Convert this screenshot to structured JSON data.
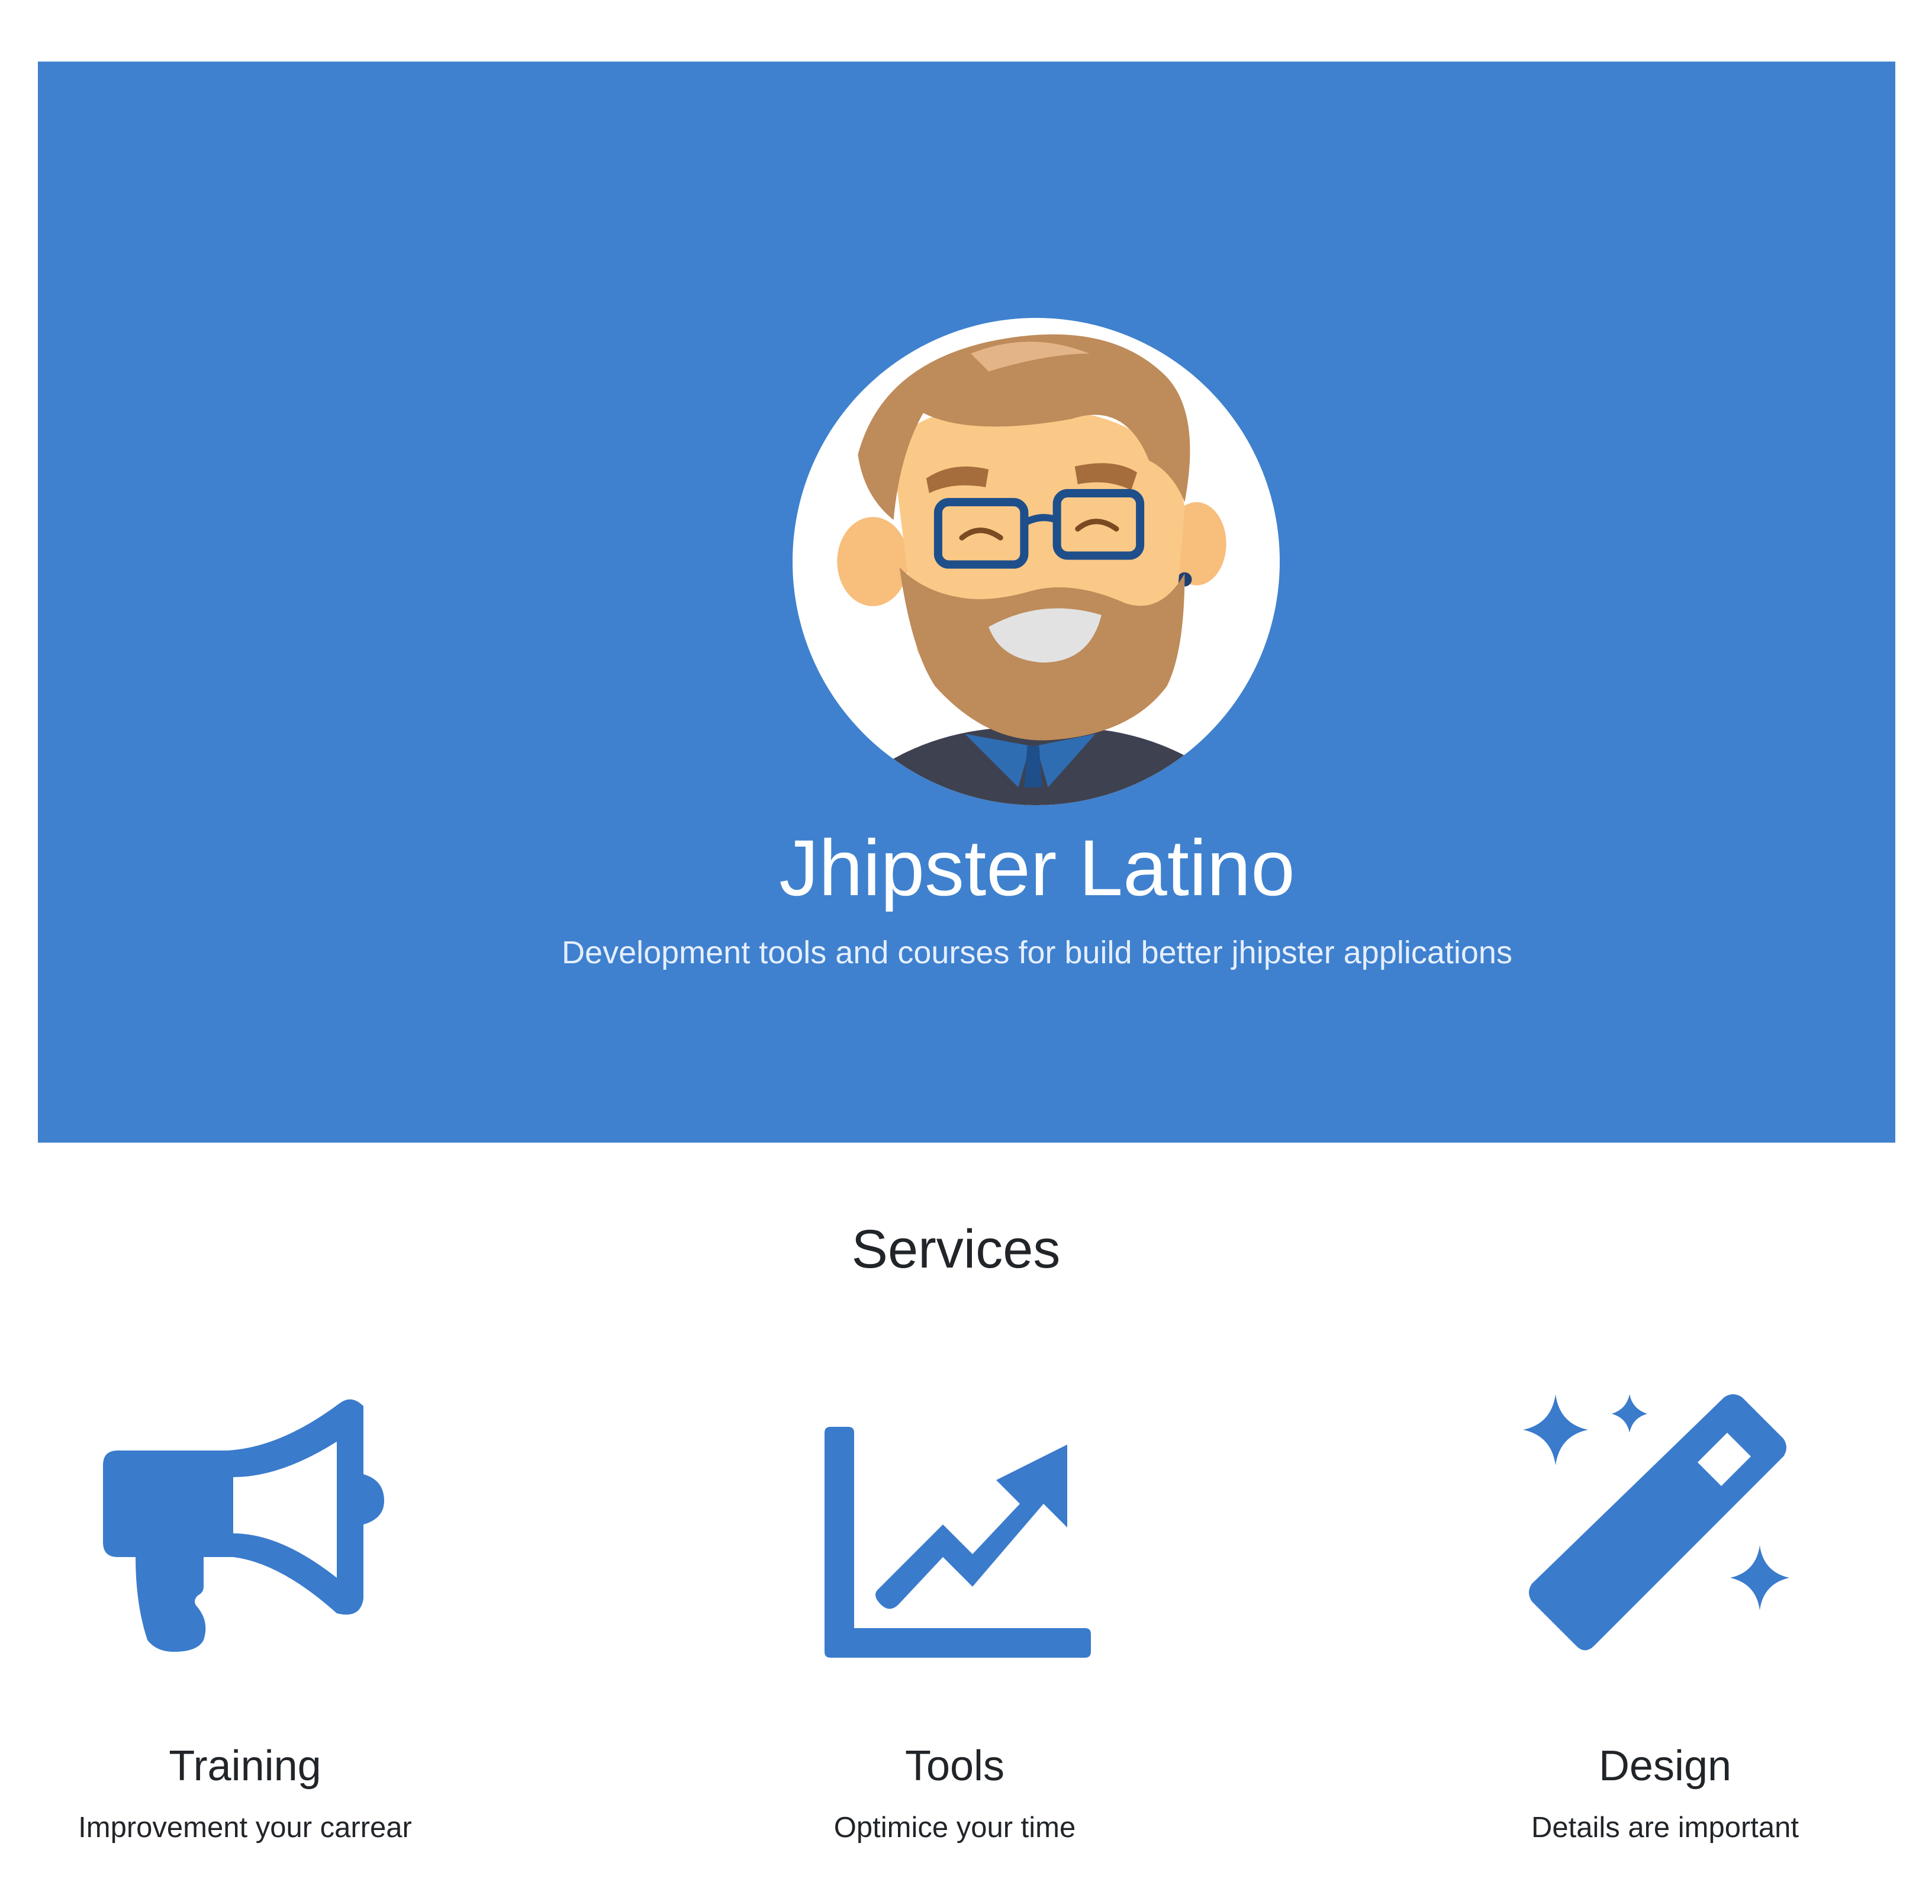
{
  "hero": {
    "title": "Jhipster Latino",
    "subtitle": "Development tools and courses for build better jhipster applications",
    "background_color": "#3f81ce",
    "avatar_icon": "hipster-avatar"
  },
  "services": {
    "heading": "Services",
    "icon_color": "#3a7bcc",
    "items": [
      {
        "icon": "megaphone-icon",
        "label": "Training",
        "description": "Improvement your carrear"
      },
      {
        "icon": "chart-line-icon",
        "label": "Tools",
        "description": "Optimice your time"
      },
      {
        "icon": "magic-wand-icon",
        "label": "Design",
        "description": "Details are important"
      }
    ]
  }
}
